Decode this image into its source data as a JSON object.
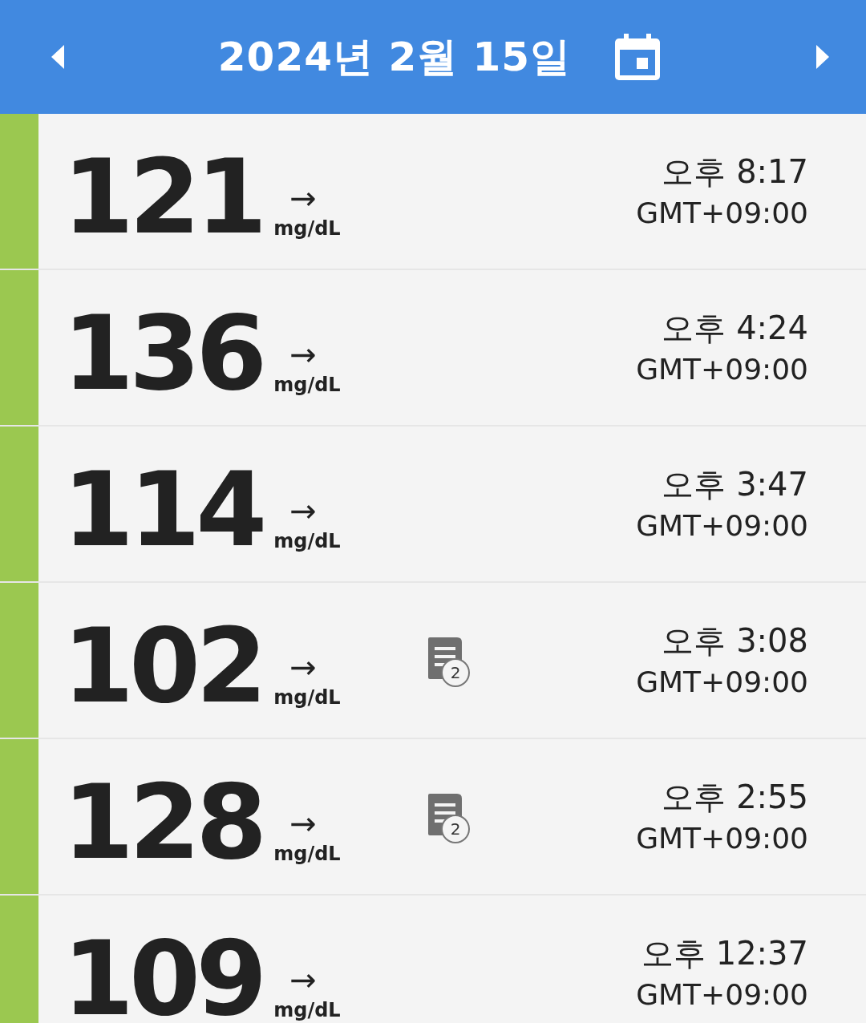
{
  "header": {
    "date": "2024년 2월 15일"
  },
  "readings": [
    {
      "value": "121",
      "unit": "mg/dL",
      "trend": "→",
      "color": "#9bc850",
      "time": "오후 8:17",
      "timezone": "GMT+09:00"
    },
    {
      "value": "136",
      "unit": "mg/dL",
      "trend": "→",
      "color": "#9bc850",
      "time": "오후 4:24",
      "timezone": "GMT+09:00"
    },
    {
      "value": "114",
      "unit": "mg/dL",
      "trend": "→",
      "color": "#9bc850",
      "time": "오후 3:47",
      "timezone": "GMT+09:00"
    },
    {
      "value": "102",
      "unit": "mg/dL",
      "trend": "→",
      "color": "#9bc850",
      "note_count": "2",
      "time": "오후 3:08",
      "timezone": "GMT+09:00"
    },
    {
      "value": "128",
      "unit": "mg/dL",
      "trend": "→",
      "color": "#9bc850",
      "note_count": "2",
      "time": "오후 2:55",
      "timezone": "GMT+09:00"
    },
    {
      "value": "109",
      "unit": "mg/dL",
      "trend": "→",
      "color": "#9bc850",
      "time": "오후 12:37",
      "timezone": "GMT+09:00"
    }
  ]
}
